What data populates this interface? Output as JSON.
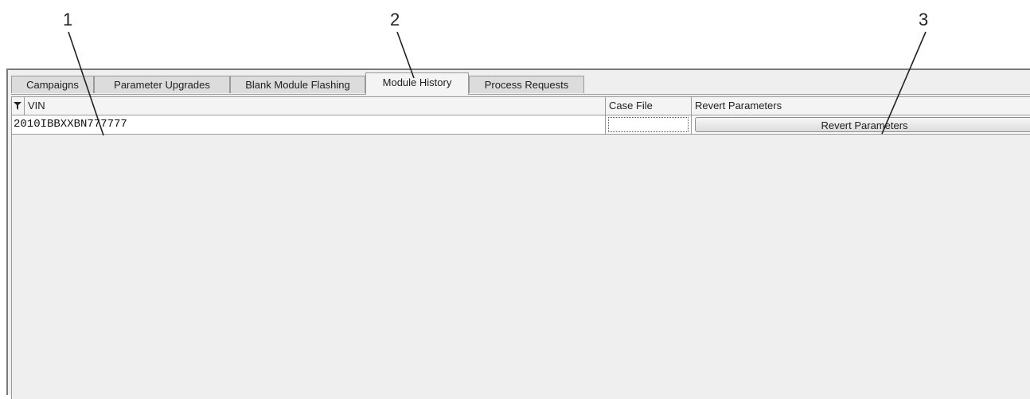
{
  "callouts": [
    "1",
    "2",
    "3"
  ],
  "tabs": [
    {
      "label": "Campaigns",
      "active": false
    },
    {
      "label": "Parameter Upgrades",
      "active": false
    },
    {
      "label": "Blank Module Flashing",
      "active": false
    },
    {
      "label": "Module History",
      "active": true
    },
    {
      "label": "Process Requests",
      "active": false
    }
  ],
  "table": {
    "filter_icon": "filter-icon",
    "columns": [
      "VIN",
      "Case File",
      "Revert Parameters"
    ],
    "rows": [
      {
        "vin": "2010IBBXXBN777777",
        "case_file": "",
        "revert_label": "Revert Parameters"
      }
    ]
  }
}
